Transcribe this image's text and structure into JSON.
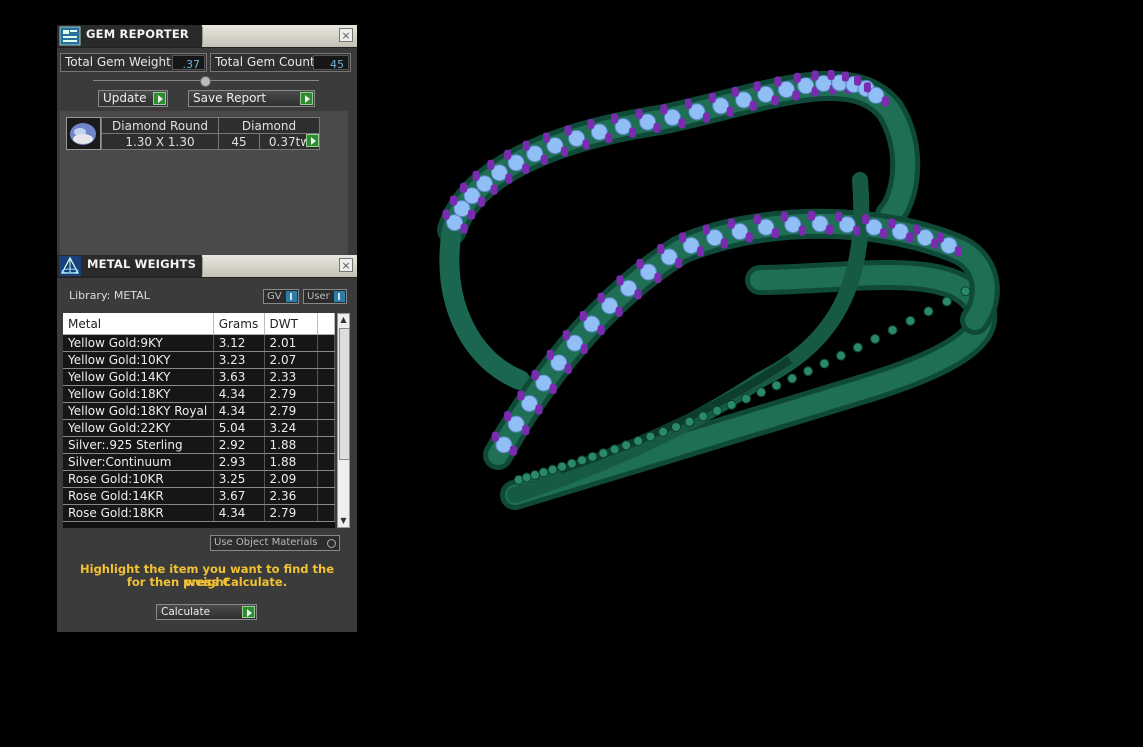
{
  "gem_reporter": {
    "title": "GEM REPORTER",
    "close_label": "×",
    "total_weight_label": "Total Gem Weight",
    "total_weight_value": ".37",
    "total_count_label": "Total Gem Count",
    "total_count_value": "45",
    "update_label": "Update",
    "save_report_label": "Save Report",
    "gem_row": {
      "shape": "Diamond Round",
      "material": "Diamond",
      "size": "1.30 X 1.30",
      "count": "45",
      "weight": "0.37tw"
    }
  },
  "metal_weights": {
    "title": "METAL WEIGHTS",
    "close_label": "×",
    "library_label": "Library: METAL",
    "gv_label": "GV",
    "user_label": "User",
    "columns": [
      "Metal",
      "Grams",
      "DWT"
    ],
    "rows": [
      [
        "Yellow Gold:9KY",
        "3.12",
        "2.01"
      ],
      [
        "Yellow Gold:10KY",
        "3.23",
        "2.07"
      ],
      [
        "Yellow Gold:14KY",
        "3.63",
        "2.33"
      ],
      [
        "Yellow Gold:18KY",
        "4.34",
        "2.79"
      ],
      [
        "Yellow Gold:18KY Royal",
        "4.34",
        "2.79"
      ],
      [
        "Yellow Gold:22KY",
        "5.04",
        "3.24"
      ],
      [
        "Silver:.925 Sterling",
        "2.92",
        "1.88"
      ],
      [
        "Silver:Continuum",
        "2.93",
        "1.88"
      ],
      [
        "Rose Gold:10KR",
        "3.25",
        "2.09"
      ],
      [
        "Rose Gold:14KR",
        "3.67",
        "2.36"
      ],
      [
        "Rose Gold:18KR",
        "4.34",
        "2.79"
      ]
    ],
    "use_object_materials_label": "Use Object Materials",
    "hint_line1": "Highlight the item you want to find the weight",
    "hint_line2": "for then press Calculate.",
    "calculate_label": "Calculate"
  },
  "colors": {
    "metal": "#1f6f54",
    "stone": "#8fbff5",
    "prong": "#7a2bb0",
    "accent_green": "#2e8b2e",
    "hint_yellow": "#f2c232"
  }
}
